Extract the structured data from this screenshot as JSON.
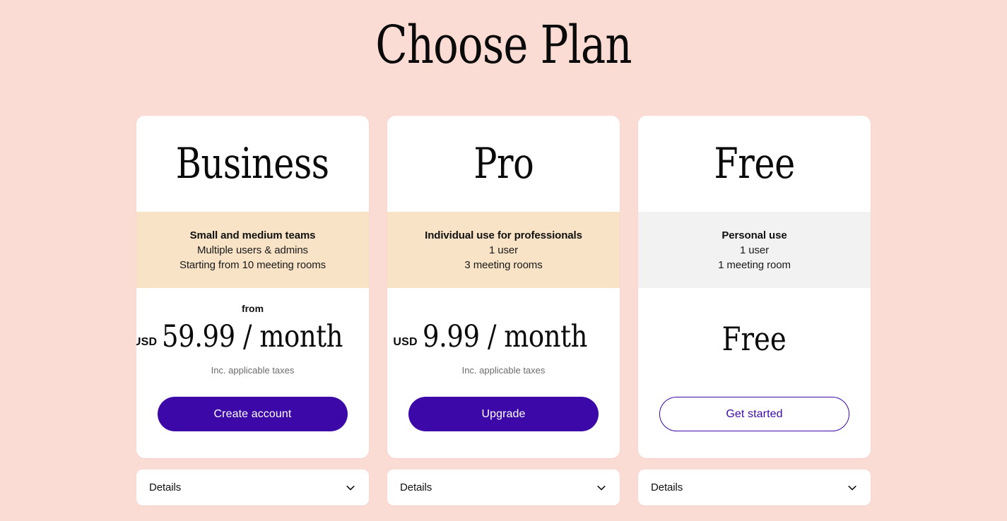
{
  "header": {
    "title": "Choose Plan"
  },
  "theme": {
    "background": "#fbdcd4",
    "card_background": "#ffffff",
    "band_cream": "#f8e3c6",
    "band_grey": "#f2f2f2",
    "accent_purple": "#3c08a7",
    "text_primary": "#0a0a0a",
    "text_muted": "#6b6b6b"
  },
  "plans": [
    {
      "id": "business",
      "name": "Business",
      "band_style": "cream",
      "band_title": "Small and medium teams",
      "band_lines": [
        "Multiple users & admins",
        "Starting from 10 meeting rooms"
      ],
      "from_label": "from",
      "currency": "USD",
      "price": "59.99 / month",
      "price_note": "Inc. applicable taxes",
      "cta_label": "Create account",
      "cta_style": "solid",
      "details_label": "Details"
    },
    {
      "id": "pro",
      "name": "Pro",
      "band_style": "cream",
      "band_title": "Individual use for professionals",
      "band_lines": [
        "1 user",
        "3 meeting rooms"
      ],
      "from_label": "",
      "currency": "USD",
      "price": "9.99 / month",
      "price_note": "Inc. applicable taxes",
      "cta_label": "Upgrade",
      "cta_style": "solid",
      "details_label": "Details"
    },
    {
      "id": "free",
      "name": "Free",
      "band_style": "grey",
      "band_title": "Personal use",
      "band_lines": [
        "1 user",
        "1 meeting room"
      ],
      "from_label": "",
      "currency": "",
      "price": "Free",
      "price_note": "",
      "cta_label": "Get started",
      "cta_style": "outline",
      "details_label": "Details"
    }
  ],
  "icons": {
    "chevron_down": "chevron-down-icon"
  }
}
